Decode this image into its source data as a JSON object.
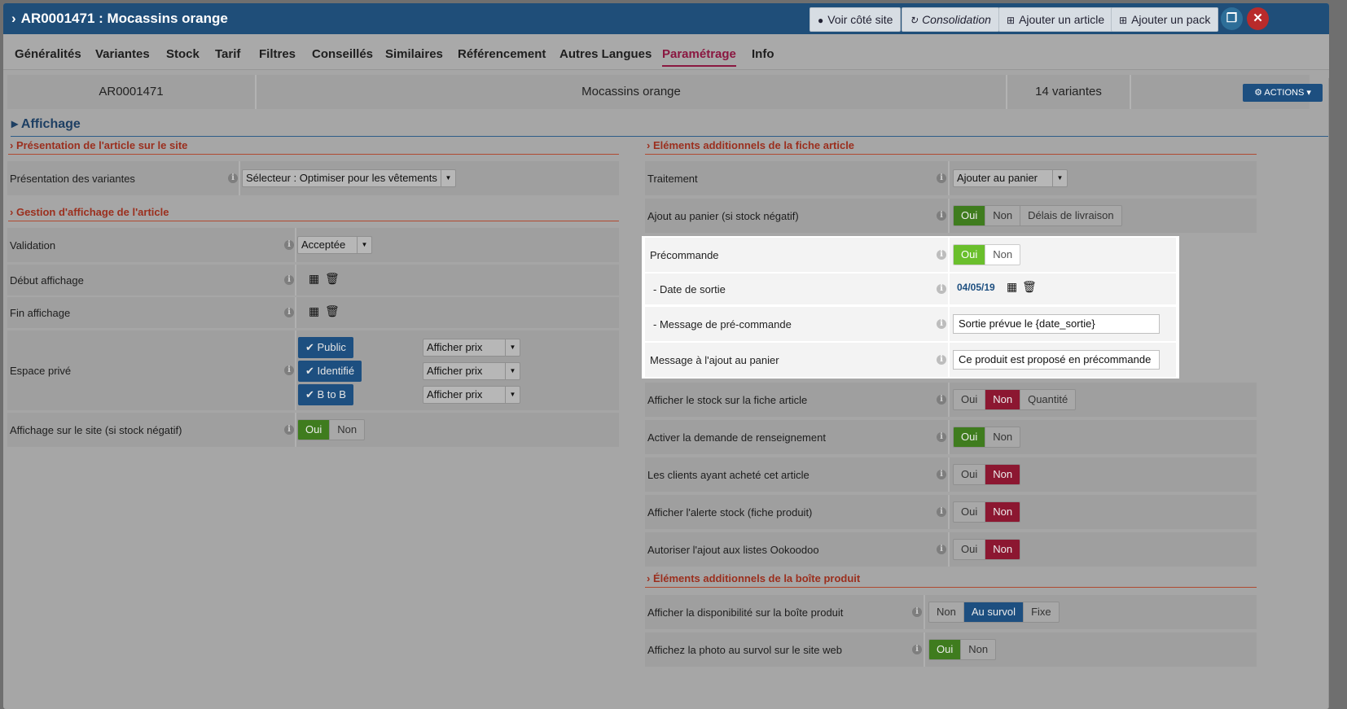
{
  "title": "AR0001471 : Mocassins orange",
  "header_buttons": {
    "voir": "Voir côté site",
    "consolidation": "Consolidation",
    "ajouter_article": "Ajouter un article",
    "ajouter_pack": "Ajouter un pack"
  },
  "tabs": [
    "Généralités",
    "Variantes",
    "Stock",
    "Tarif",
    "Filtres",
    "Conseillés",
    "Similaires",
    "Référencement",
    "Autres Langues",
    "Paramétrage",
    "Info"
  ],
  "active_tab": "Paramétrage",
  "info": {
    "ref": "AR0001471",
    "name": "Mocassins orange",
    "variants": "14 variantes",
    "actions": "ACTIONS"
  },
  "section_title": "Affichage",
  "left": {
    "presentation_title": "Présentation de l'article sur le site",
    "presentation_label": "Présentation des variantes",
    "presentation_value": "Sélecteur : Optimiser pour les vêtements",
    "gestion_title": "Gestion d'affichage de l'article",
    "validation_label": "Validation",
    "validation_value": "Acceptée",
    "debut_label": "Début affichage",
    "fin_label": "Fin affichage",
    "espace_label": "Espace privé",
    "espaces": [
      {
        "name": "Public",
        "value": "Afficher prix"
      },
      {
        "name": "Identifié",
        "value": "Afficher prix"
      },
      {
        "name": "B to B",
        "value": "Afficher prix"
      }
    ],
    "stock_neg_label": "Affichage sur le site (si stock négatif)",
    "stock_neg_options": [
      "Oui",
      "Non"
    ]
  },
  "right": {
    "fiche_title": "Eléments additionnels de la fiche article",
    "traitement_label": "Traitement",
    "traitement_value": "Ajouter au panier",
    "ajout_label": "Ajout au panier (si stock négatif)",
    "ajout_options": [
      "Oui",
      "Non",
      "Délais de livraison"
    ],
    "precommande_label": "Précommande",
    "precommande_options": [
      "Oui",
      "Non"
    ],
    "date_label": "- Date de sortie",
    "date_value": "04/05/19",
    "msg_pre_label": "- Message de pré-commande",
    "msg_pre_value": "Sortie prévue le {date_sortie}",
    "msg_panier_label": "Message à l'ajout au panier",
    "msg_panier_value": "Ce produit est proposé en précommande",
    "stock_label": "Afficher le stock sur la fiche article",
    "stock_options": [
      "Oui",
      "Non",
      "Quantité"
    ],
    "renseignement_label": "Activer la demande de renseignement",
    "renseignement_options": [
      "Oui",
      "Non"
    ],
    "clients_label": "Les clients ayant acheté cet article",
    "clients_options": [
      "Oui",
      "Non"
    ],
    "alerte_label": "Afficher l'alerte stock (fiche produit)",
    "alerte_options": [
      "Oui",
      "Non"
    ],
    "listes_label": "Autoriser l'ajout aux listes Ookoodoo",
    "listes_options": [
      "Oui",
      "Non"
    ],
    "boite_title": "Éléments additionnels de la boîte produit",
    "dispo_label": "Afficher la disponibilité sur la boîte produit",
    "dispo_options": [
      "Non",
      "Au survol",
      "Fixe"
    ],
    "photo_label": "Affichez la photo au survol sur le site web",
    "photo_options": [
      "Oui",
      "Non"
    ]
  },
  "colors": {
    "header": "#1f4e79",
    "active_tab": "#8a1740",
    "yes": "#3f7c1e",
    "no": "#8c1731",
    "selected": "#1d4f80",
    "highlight": "#ffffff"
  }
}
